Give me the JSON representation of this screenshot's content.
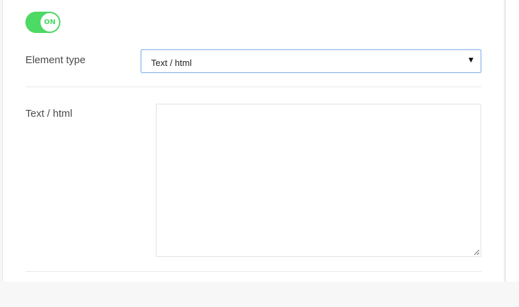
{
  "toggle": {
    "label": "ON",
    "state": "on",
    "color": "#4cd964"
  },
  "element_type": {
    "label": "Element type",
    "selected": "Text / html",
    "caret_icon": "caret-down-icon"
  },
  "text_html": {
    "label": "Text / html",
    "value": "",
    "resize_icon": "resize-grip-icon"
  },
  "colors": {
    "accent_border": "#8ab4f0"
  }
}
